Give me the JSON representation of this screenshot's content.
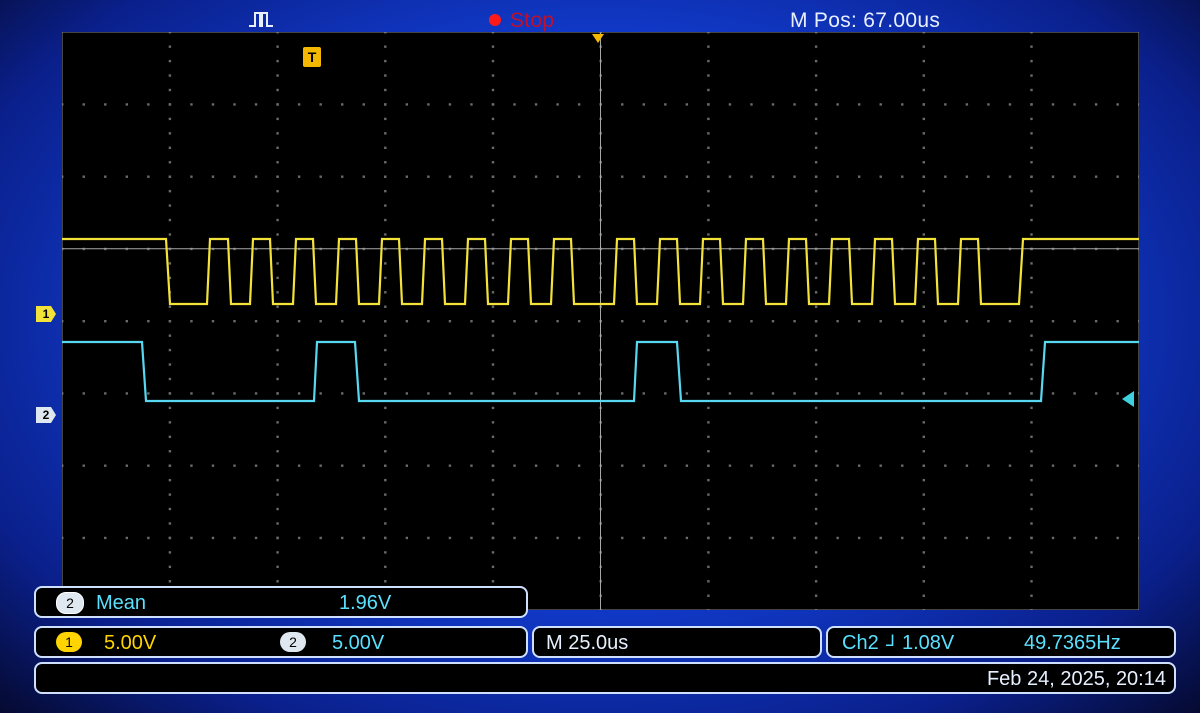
{
  "top": {
    "run_status": "Stop",
    "m_pos": "M Pos: 67.00us"
  },
  "channels": {
    "ch1_marker": "1",
    "ch2_marker": "2",
    "trigger_marker": "T"
  },
  "measurement": {
    "channel": "2",
    "label": "Mean",
    "value": "1.96V"
  },
  "scale": {
    "ch1_badge": "1",
    "ch1_scale": "5.00V",
    "ch2_badge": "2",
    "ch2_scale": "5.00V"
  },
  "timebase": {
    "label": "M 25.0us"
  },
  "trigger": {
    "source": "Ch2",
    "slope_symbol": "⅃",
    "level": "1.08V",
    "frequency": "49.7365Hz"
  },
  "datetime": "Feb 24, 2025, 20:14",
  "colors": {
    "ch1": "#f2e23a",
    "ch2": "#58d8f0",
    "trigger": "#f5b800",
    "run_stop": "#ff1a1a"
  },
  "icons": {
    "acquire": "pulse-icon",
    "trigger_marker": "trigger-t-icon"
  }
}
